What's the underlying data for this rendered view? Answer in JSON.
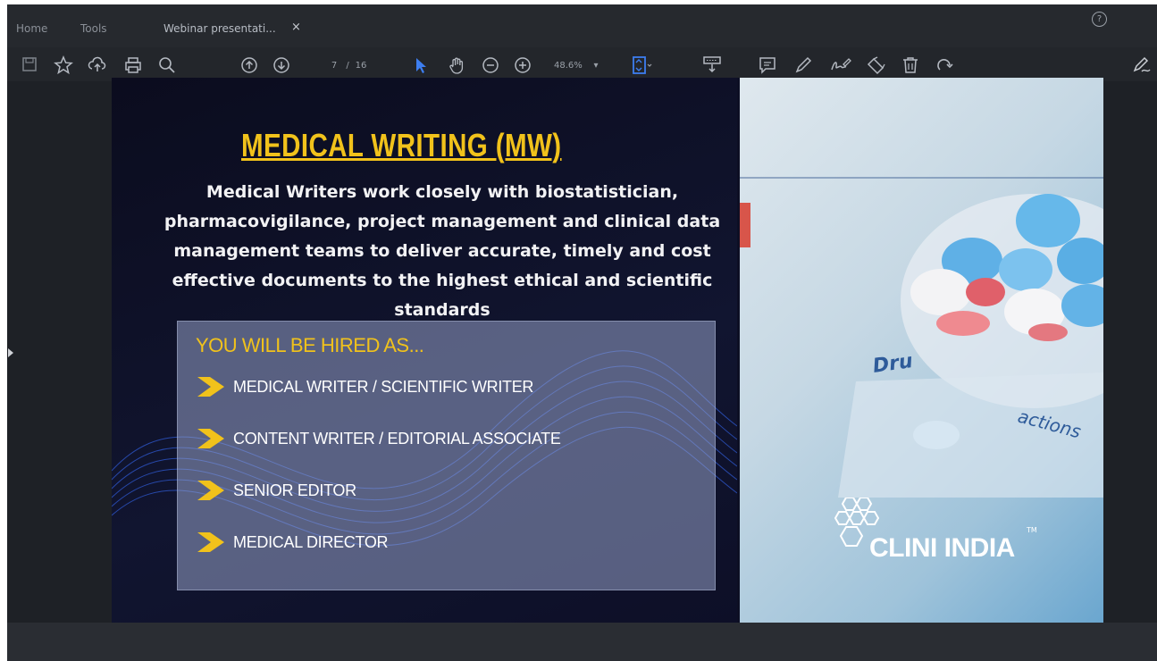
{
  "tabs": {
    "home": "Home",
    "tools": "Tools",
    "document": "Webinar presentati...",
    "close": "×"
  },
  "toolbar": {
    "page_current": "7",
    "page_separator": "/",
    "page_total": "16",
    "zoom": "48.6%",
    "icons": [
      "save-icon",
      "star-icon",
      "upload-icon",
      "print-icon",
      "search-icon",
      "page-up-icon",
      "page-down-icon",
      "select-cursor-icon",
      "hand-icon",
      "zoom-out-icon",
      "zoom-in-icon",
      "fit-page-icon",
      "stamp-icon",
      "comment-icon",
      "pen-icon",
      "sign-icon",
      "redact-icon",
      "delete-icon",
      "rotate-icon",
      "edit-icon"
    ]
  },
  "slide": {
    "title": "MEDICAL WRITING (MW)",
    "body": "Medical Writers work closely with biostatistician, pharmacovigilance, project management and clinical data management teams to deliver accurate, timely and cost effective documents to the highest ethical and scientific standards",
    "hired_heading": "YOU WILL BE HIRED AS...",
    "roles": [
      "MEDICAL WRITER / SCIENTIFIC WRITER",
      "CONTENT WRITER / EDITORIAL ASSOCIATE",
      "SENIOR EDITOR",
      "MEDICAL DIRECTOR"
    ],
    "logo": "CLINI INDIA",
    "logo_tm": "TM"
  },
  "colors": {
    "accent_yellow": "#f1c21b",
    "slide_bg": "#0d0f24",
    "tool_blue": "#3d7ef0"
  }
}
